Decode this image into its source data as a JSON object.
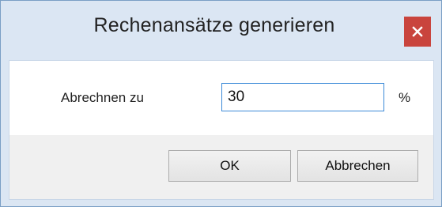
{
  "window": {
    "title": "Rechenansätze generieren",
    "close_label": "×"
  },
  "form": {
    "label": "Abrechnen zu",
    "value": "30",
    "unit": "%"
  },
  "buttons": {
    "ok": "OK",
    "cancel": "Abbrechen"
  },
  "colors": {
    "title_bar": "#dbe6f3",
    "close_button": "#c9443d",
    "input_border": "#3c8ad8"
  }
}
